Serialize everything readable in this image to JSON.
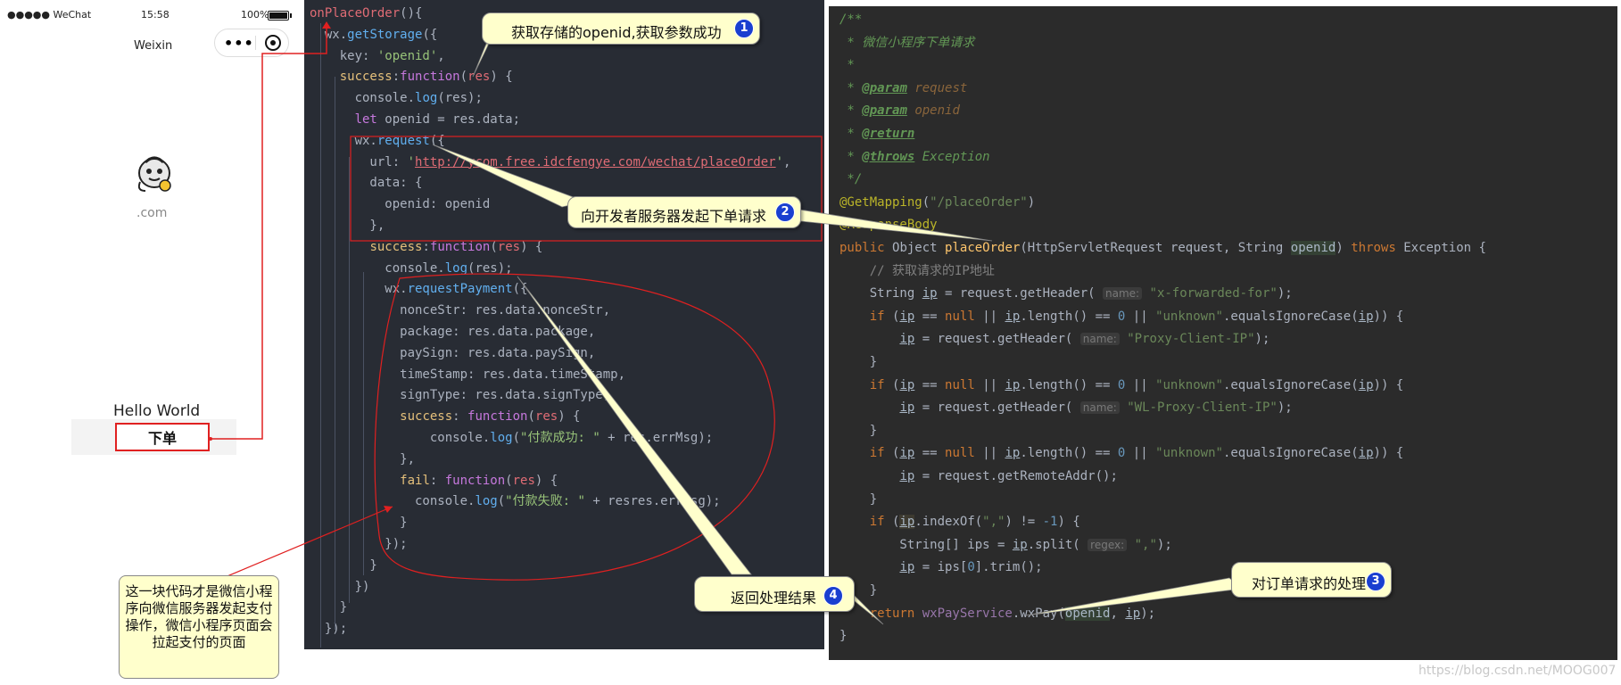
{
  "phone": {
    "carrier": "●●●●● WeChat",
    "time": "15:58",
    "battery": "100%",
    "title": "Weixin",
    "menu_dots": "•••",
    "domain": ".com",
    "hello": "Hello World",
    "order_button": "下单"
  },
  "js_code": [
    [
      [
        "p",
        "onPlaceOrder"
      ],
      [
        "w",
        "(){"
      ]
    ],
    [
      [
        "w",
        "  wx."
      ],
      [
        "f",
        "getStorage"
      ],
      [
        "w",
        "({"
      ]
    ],
    [
      [
        "w",
        "    key: "
      ],
      [
        "s",
        "'openid'"
      ],
      [
        "w",
        ","
      ]
    ],
    [
      [
        "w",
        "    "
      ],
      [
        "y",
        "success"
      ],
      [
        "w",
        ":"
      ],
      [
        "k",
        "function"
      ],
      [
        "w",
        "("
      ],
      [
        "p",
        "res"
      ],
      [
        "w",
        ") {"
      ]
    ],
    [
      [
        "w",
        "      console."
      ],
      [
        "f",
        "log"
      ],
      [
        "w",
        "(res);"
      ]
    ],
    [
      [
        "w",
        "      "
      ],
      [
        "k",
        "let"
      ],
      [
        "w",
        " openid = res.data;"
      ]
    ],
    [
      [
        "w",
        "      wx."
      ],
      [
        "f",
        "request"
      ],
      [
        "w",
        "({"
      ]
    ],
    [
      [
        "w",
        "        url: "
      ],
      [
        "s",
        "'"
      ],
      [
        "su",
        "http://ycom.free.idcfengye.com/wechat/placeOrder"
      ],
      [
        "s",
        "'"
      ],
      [
        "w",
        ","
      ]
    ],
    [
      [
        "w",
        "        data: {"
      ]
    ],
    [
      [
        "w",
        "          openid: openid"
      ]
    ],
    [
      [
        "w",
        "        },"
      ]
    ],
    [
      [
        "w",
        "        "
      ],
      [
        "y",
        "success"
      ],
      [
        "w",
        ":"
      ],
      [
        "k",
        "function"
      ],
      [
        "w",
        "("
      ],
      [
        "p",
        "res"
      ],
      [
        "w",
        ") {"
      ]
    ],
    [
      [
        "w",
        "          console."
      ],
      [
        "f",
        "log"
      ],
      [
        "w",
        "(res);"
      ]
    ],
    [
      [
        "w",
        "          wx."
      ],
      [
        "f",
        "requestPayment"
      ],
      [
        "w",
        "({"
      ]
    ],
    [
      [
        "w",
        "            nonceStr: res.data.nonceStr,"
      ]
    ],
    [
      [
        "w",
        "            package: res.data.package,"
      ]
    ],
    [
      [
        "w",
        "            paySign: res.data.paySign,"
      ]
    ],
    [
      [
        "w",
        "            timeStamp: res.data.timeStamp,"
      ]
    ],
    [
      [
        "w",
        "            signType: res.data.signType,"
      ]
    ],
    [
      [
        "w",
        "            "
      ],
      [
        "y",
        "success"
      ],
      [
        "w",
        ": "
      ],
      [
        "k",
        "function"
      ],
      [
        "w",
        "("
      ],
      [
        "p",
        "res"
      ],
      [
        "w",
        ") {"
      ]
    ],
    [
      [
        "w",
        "                console."
      ],
      [
        "f",
        "log"
      ],
      [
        "w",
        "("
      ],
      [
        "s",
        "\"付款成功: \""
      ],
      [
        "w",
        " + res.errMsg);"
      ]
    ],
    [
      [
        "w",
        "            },"
      ]
    ],
    [
      [
        "w",
        "            "
      ],
      [
        "y",
        "fail"
      ],
      [
        "w",
        ": "
      ],
      [
        "k",
        "function"
      ],
      [
        "w",
        "("
      ],
      [
        "p",
        "res"
      ],
      [
        "w",
        ") {"
      ]
    ],
    [
      [
        "w",
        "              console."
      ],
      [
        "f",
        "log"
      ],
      [
        "w",
        "("
      ],
      [
        "s",
        "\"付款失败: \""
      ],
      [
        "w",
        " + resres.errMsg);"
      ]
    ],
    [
      [
        "w",
        "            }"
      ]
    ],
    [
      [
        "w",
        "          });"
      ]
    ],
    [
      [
        "w",
        "        }"
      ]
    ],
    [
      [
        "w",
        "      })"
      ]
    ],
    [
      [
        "w",
        "    }"
      ]
    ],
    [
      [
        "w",
        "  });"
      ]
    ]
  ],
  "java_code": [
    [
      [
        "jc",
        "/**"
      ]
    ],
    [
      [
        "jc",
        " * 微信小程序下单请求"
      ]
    ],
    [
      [
        "jc",
        " *"
      ]
    ],
    [
      [
        "jc",
        " * "
      ],
      [
        "jt",
        "@param"
      ],
      [
        "jc",
        " "
      ],
      [
        "jp",
        "request"
      ]
    ],
    [
      [
        "jc",
        " * "
      ],
      [
        "jt",
        "@param"
      ],
      [
        "jc",
        " "
      ],
      [
        "jp",
        "openid"
      ]
    ],
    [
      [
        "jc",
        " * "
      ],
      [
        "jt",
        "@return"
      ]
    ],
    [
      [
        "jc",
        " * "
      ],
      [
        "jt",
        "@throws"
      ],
      [
        "jc",
        " Exception"
      ]
    ],
    [
      [
        "jc",
        " */"
      ]
    ],
    [
      [
        "ja",
        "@GetMapping"
      ],
      [
        "w",
        "("
      ],
      [
        "js2",
        "\"/placeOrder\""
      ],
      [
        "w",
        ")"
      ]
    ],
    [
      [
        "ja",
        "@ResponseBody"
      ]
    ],
    [
      [
        "jk",
        "public "
      ],
      [
        "w",
        "Object "
      ],
      [
        "jm",
        "placeOrder"
      ],
      [
        "w",
        "(HttpServletRequest request, String "
      ],
      [
        "hv",
        "openid"
      ],
      [
        "w",
        ") "
      ],
      [
        "jk",
        "throws "
      ],
      [
        "w",
        "Exception {"
      ]
    ],
    [
      [
        "jg",
        "    // 获取请求的IP地址"
      ]
    ],
    [
      [
        "w",
        "    String "
      ],
      [
        "u",
        "ip"
      ],
      [
        "w",
        " = request.getHeader( "
      ],
      [
        "jh",
        "name:"
      ],
      [
        "js2",
        " \"x-forwarded-for\""
      ],
      [
        "w",
        ");"
      ]
    ],
    [
      [
        "w",
        "    "
      ],
      [
        "jk",
        "if "
      ],
      [
        "w",
        "("
      ],
      [
        "u",
        "ip"
      ],
      [
        "w",
        " == "
      ],
      [
        "jk",
        "null "
      ],
      [
        "w",
        "|| "
      ],
      [
        "u",
        "ip"
      ],
      [
        "w",
        ".length() == "
      ],
      [
        "jn",
        "0 "
      ],
      [
        "w",
        "|| "
      ],
      [
        "js2",
        "\"unknown\""
      ],
      [
        "w",
        ".equalsIgnoreCase("
      ],
      [
        "u",
        "ip"
      ],
      [
        "w",
        ")) {"
      ]
    ],
    [
      [
        "w",
        "        "
      ],
      [
        "u",
        "ip"
      ],
      [
        "w",
        " = request.getHeader( "
      ],
      [
        "jh",
        "name:"
      ],
      [
        "js2",
        " \"Proxy-Client-IP\""
      ],
      [
        "w",
        ");"
      ]
    ],
    [
      [
        "w",
        "    }"
      ]
    ],
    [
      [
        "w",
        "    "
      ],
      [
        "jk",
        "if "
      ],
      [
        "w",
        "("
      ],
      [
        "u",
        "ip"
      ],
      [
        "w",
        " == "
      ],
      [
        "jk",
        "null "
      ],
      [
        "w",
        "|| "
      ],
      [
        "u",
        "ip"
      ],
      [
        "w",
        ".length() == "
      ],
      [
        "jn",
        "0 "
      ],
      [
        "w",
        "|| "
      ],
      [
        "js2",
        "\"unknown\""
      ],
      [
        "w",
        ".equalsIgnoreCase("
      ],
      [
        "u",
        "ip"
      ],
      [
        "w",
        ")) {"
      ]
    ],
    [
      [
        "w",
        "        "
      ],
      [
        "u",
        "ip"
      ],
      [
        "w",
        " = request.getHeader( "
      ],
      [
        "jh",
        "name:"
      ],
      [
        "js2",
        " \"WL-Proxy-Client-IP\""
      ],
      [
        "w",
        ");"
      ]
    ],
    [
      [
        "w",
        "    }"
      ]
    ],
    [
      [
        "w",
        "    "
      ],
      [
        "jk",
        "if "
      ],
      [
        "w",
        "("
      ],
      [
        "u",
        "ip"
      ],
      [
        "w",
        " == "
      ],
      [
        "jk",
        "null "
      ],
      [
        "w",
        "|| "
      ],
      [
        "u",
        "ip"
      ],
      [
        "w",
        ".length() == "
      ],
      [
        "jn",
        "0 "
      ],
      [
        "w",
        "|| "
      ],
      [
        "js2",
        "\"unknown\""
      ],
      [
        "w",
        ".equalsIgnoreCase("
      ],
      [
        "u",
        "ip"
      ],
      [
        "w",
        ")) {"
      ]
    ],
    [
      [
        "w",
        "        "
      ],
      [
        "u",
        "ip"
      ],
      [
        "w",
        " = request.getRemoteAddr();"
      ]
    ],
    [
      [
        "w",
        "    }"
      ]
    ],
    [
      [
        "w",
        "    "
      ],
      [
        "jk",
        "if "
      ],
      [
        "w",
        "("
      ],
      [
        "hu",
        "ip"
      ],
      [
        "w",
        ".indexOf("
      ],
      [
        "js2",
        "\",\""
      ],
      [
        "w",
        ") != "
      ],
      [
        "jn",
        "-1"
      ],
      [
        "w",
        ") {"
      ]
    ],
    [
      [
        "w",
        "        String[] ips = "
      ],
      [
        "u",
        "ip"
      ],
      [
        "w",
        ".split( "
      ],
      [
        "jh",
        "regex:"
      ],
      [
        "js2",
        " \",\""
      ],
      [
        "w",
        ");"
      ]
    ],
    [
      [
        "w",
        "        "
      ],
      [
        "u",
        "ip"
      ],
      [
        "w",
        " = ips["
      ],
      [
        "jn",
        "0"
      ],
      [
        "w",
        "].trim();"
      ]
    ],
    [
      [
        "w",
        "    }"
      ]
    ],
    [
      [
        "jk",
        "    return "
      ],
      [
        "jv",
        "wxPayService"
      ],
      [
        "w",
        ".wxPay("
      ],
      [
        "hv",
        "openid"
      ],
      [
        "w",
        ", "
      ],
      [
        "u",
        "ip"
      ],
      [
        "w",
        ");"
      ]
    ],
    [
      [
        "w",
        "}"
      ]
    ]
  ],
  "callouts": {
    "c1": {
      "text": "获取存储的openid,获取参数成功",
      "num": "1"
    },
    "c2": {
      "text": "向开发者服务器发起下单请求",
      "num": "2"
    },
    "c3": {
      "text": "对订单请求的处理",
      "num": "3"
    },
    "c4": {
      "text": "返回处理结果",
      "num": "4"
    }
  },
  "note": "这一块代码才是微信小程序向微信服务器发起支付操作，微信小程序页面会拉起支付的页面",
  "watermark": "https://blog.csdn.net/MOOG007",
  "colors": {
    "js_bg": "#282c34",
    "java_bg": "#2b2b2b",
    "annotation_red": "#e02020",
    "callout_bg": "#ffffcc",
    "badge_blue": "#1a3fd0"
  }
}
